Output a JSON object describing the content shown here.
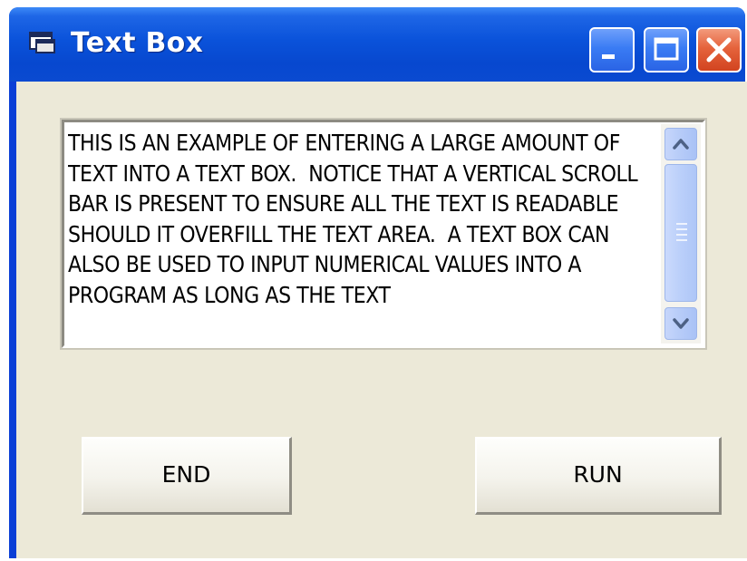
{
  "window": {
    "title": "Text Box",
    "controls": {
      "minimize_icon": "minimize-icon",
      "maximize_icon": "maximize-icon",
      "close_icon": "close-icon"
    }
  },
  "textbox": {
    "value": "THIS IS AN EXAMPLE OF ENTERING A LARGE AMOUNT OF TEXT INTO A TEXT BOX.  NOTICE THAT A VERTICAL SCROLL BAR IS PRESENT TO ENSURE ALL THE TEXT IS READABLE SHOULD IT OVERFILL THE TEXT AREA.  A TEXT BOX CAN ALSO BE USED TO INPUT NUMERICAL VALUES INTO A PROGRAM AS LONG AS THE TEXT",
    "scrollbar": {
      "up_icon": "chevron-up-icon",
      "down_icon": "chevron-down-icon"
    }
  },
  "buttons": {
    "end_label": "END",
    "run_label": "RUN"
  },
  "colors": {
    "titlebar": "#0a52da",
    "client_background": "#ece9d8",
    "close_button": "#e5633c"
  }
}
